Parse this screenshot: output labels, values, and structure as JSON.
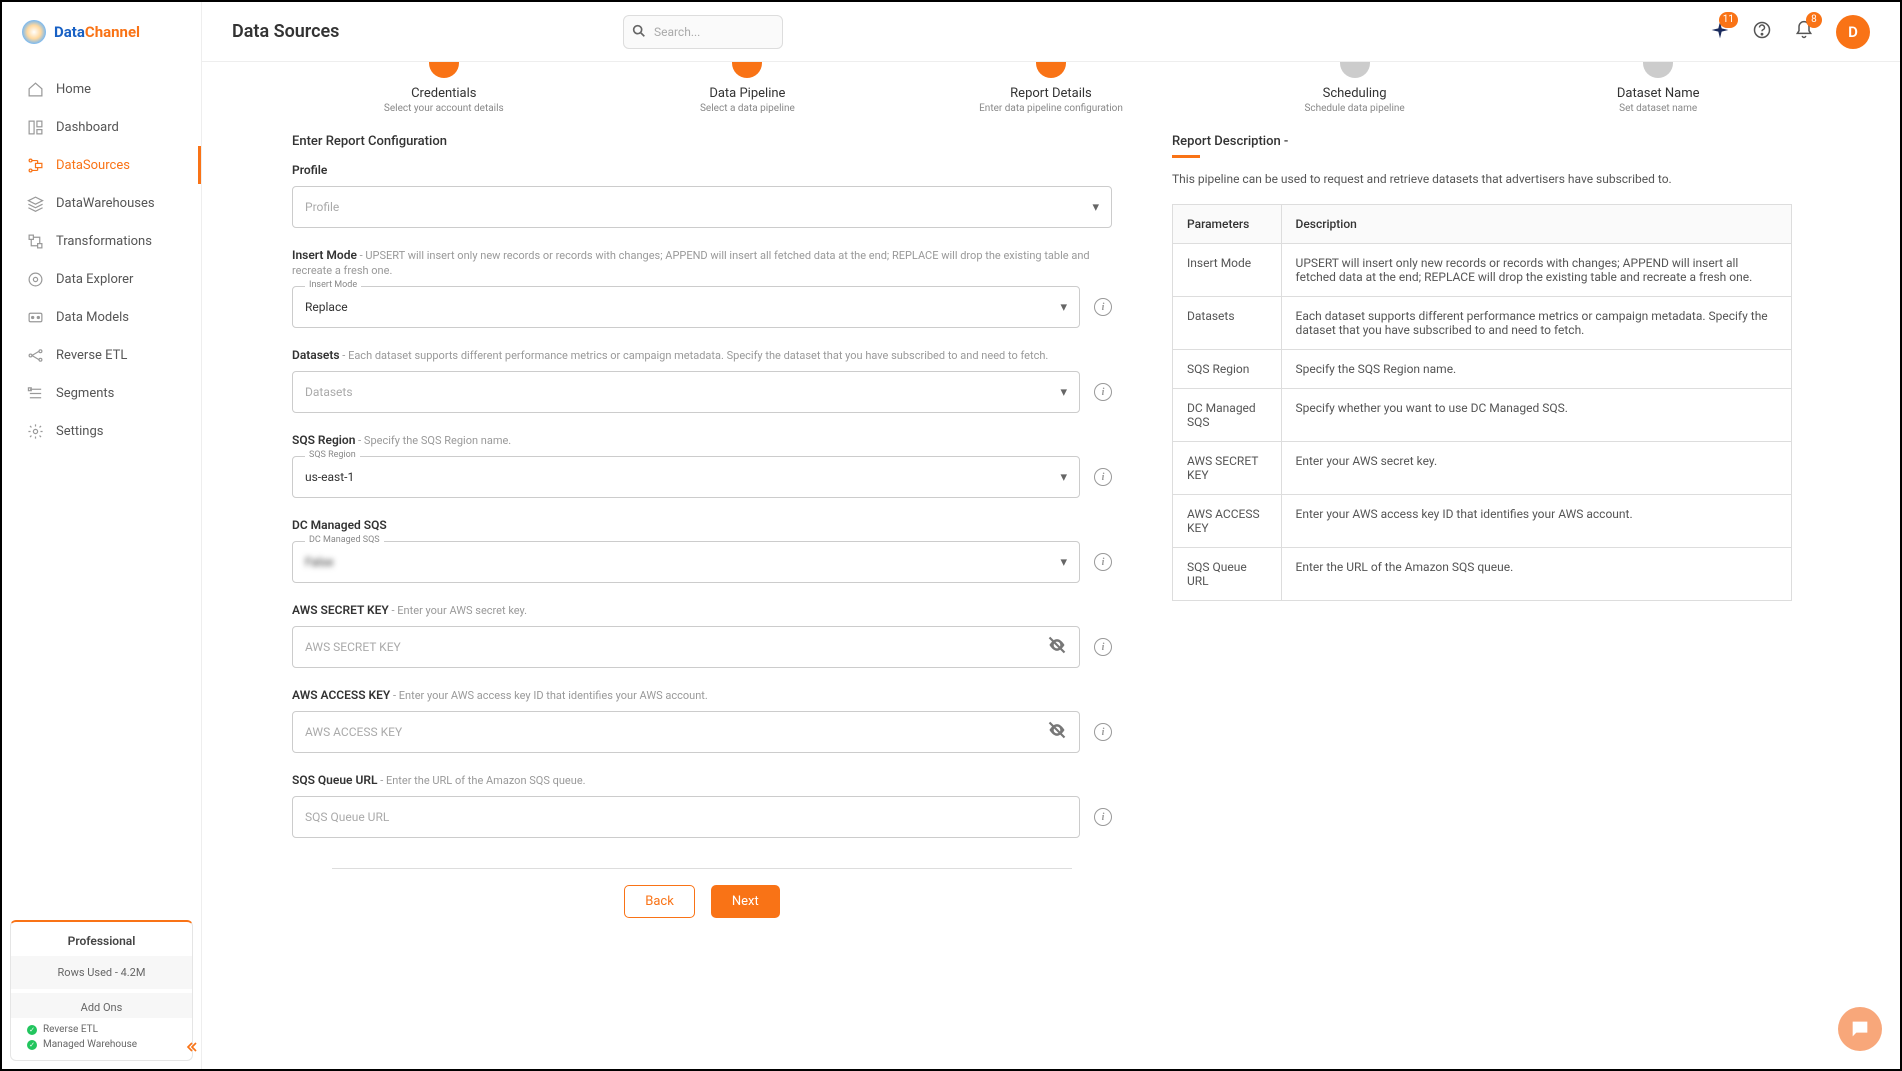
{
  "brand": {
    "p1": "Data",
    "p2": "Channel"
  },
  "page_title": "Data Sources",
  "search": {
    "placeholder": "Search..."
  },
  "badges": {
    "sparkle": "11",
    "bell": "8"
  },
  "avatar_letter": "D",
  "nav": [
    {
      "label": "Home"
    },
    {
      "label": "Dashboard"
    },
    {
      "label": "DataSources"
    },
    {
      "label": "DataWarehouses"
    },
    {
      "label": "Transformations"
    },
    {
      "label": "Data Explorer"
    },
    {
      "label": "Data Models"
    },
    {
      "label": "Reverse ETL"
    },
    {
      "label": "Segments"
    },
    {
      "label": "Settings"
    }
  ],
  "plan": {
    "title": "Professional",
    "rows_used": "Rows Used - 4.2M",
    "addons_title": "Add Ons",
    "addon1": "Reverse ETL",
    "addon2": "Managed Warehouse"
  },
  "steps": [
    {
      "title": "Credentials",
      "sub": "Select your account details"
    },
    {
      "title": "Data Pipeline",
      "sub": "Select a data pipeline"
    },
    {
      "title": "Report Details",
      "sub": "Enter data pipeline configuration"
    },
    {
      "title": "Scheduling",
      "sub": "Schedule data pipeline"
    },
    {
      "title": "Dataset Name",
      "sub": "Set dataset name"
    }
  ],
  "form": {
    "heading": "Enter Report Configuration",
    "profile": {
      "label": "Profile",
      "placeholder": "Profile"
    },
    "insert_mode": {
      "label": "Insert Mode",
      "desc": " - UPSERT will insert only new records or records with changes; APPEND will insert all fetched data at the end; REPLACE will drop the existing table and recreate a fresh one.",
      "float": "Insert Mode",
      "value": "Replace"
    },
    "datasets": {
      "label": "Datasets",
      "desc": " - Each dataset supports different performance metrics or campaign metadata. Specify the dataset that you have subscribed to and need to fetch.",
      "placeholder": "Datasets"
    },
    "sqs_region": {
      "label": "SQS Region",
      "desc": " - Specify the SQS Region name.",
      "float": "SQS Region",
      "value": "us-east-1"
    },
    "dcsqs": {
      "label": "DC Managed SQS",
      "float": "DC Managed SQS",
      "value": "False"
    },
    "secret": {
      "label": "AWS SECRET KEY",
      "desc": " - Enter your AWS secret key.",
      "placeholder": "AWS SECRET KEY"
    },
    "access": {
      "label": "AWS ACCESS KEY",
      "desc": " - Enter your AWS access key ID that identifies your AWS account.",
      "placeholder": "AWS ACCESS KEY"
    },
    "queue": {
      "label": "SQS Queue URL",
      "desc": " - Enter the URL of the Amazon SQS queue.",
      "placeholder": "SQS Queue URL"
    }
  },
  "buttons": {
    "back": "Back",
    "next": "Next"
  },
  "report_desc": {
    "heading": "Report Description -",
    "text": "This pipeline can be used to request and retrieve datasets that advertisers have subscribed to.",
    "th1": "Parameters",
    "th2": "Description",
    "rows": [
      {
        "p": "Insert Mode",
        "d": "UPSERT will insert only new records or records with changes; APPEND will insert all fetched data at the end; REPLACE will drop the existing table and recreate a fresh one."
      },
      {
        "p": "Datasets",
        "d": "Each dataset supports different performance metrics or campaign metadata. Specify the dataset that you have subscribed to and need to fetch."
      },
      {
        "p": "SQS Region",
        "d": "Specify the SQS Region name."
      },
      {
        "p": "DC Managed SQS",
        "d": "Specify whether you want to use DC Managed SQS."
      },
      {
        "p": "AWS SECRET KEY",
        "d": "Enter your AWS secret key."
      },
      {
        "p": "AWS ACCESS KEY",
        "d": "Enter your AWS access key ID that identifies your AWS account."
      },
      {
        "p": "SQS Queue URL",
        "d": "Enter the URL of the Amazon SQS queue."
      }
    ]
  }
}
